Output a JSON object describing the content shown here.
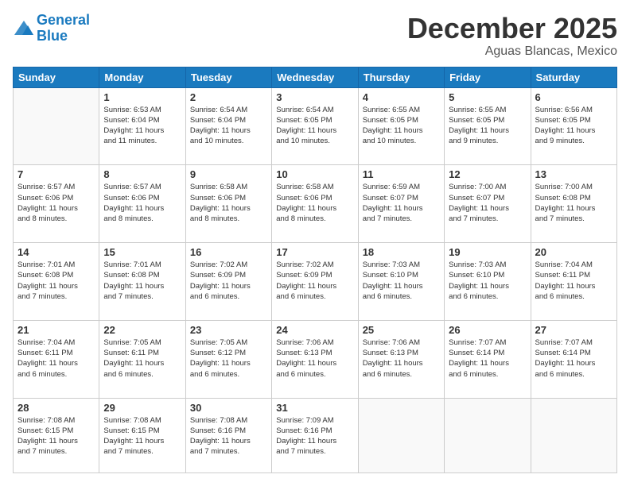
{
  "header": {
    "logo_line1": "General",
    "logo_line2": "Blue",
    "month": "December 2025",
    "location": "Aguas Blancas, Mexico"
  },
  "days_of_week": [
    "Sunday",
    "Monday",
    "Tuesday",
    "Wednesday",
    "Thursday",
    "Friday",
    "Saturday"
  ],
  "weeks": [
    [
      {
        "day": "",
        "info": ""
      },
      {
        "day": "1",
        "info": "Sunrise: 6:53 AM\nSunset: 6:04 PM\nDaylight: 11 hours\nand 11 minutes."
      },
      {
        "day": "2",
        "info": "Sunrise: 6:54 AM\nSunset: 6:04 PM\nDaylight: 11 hours\nand 10 minutes."
      },
      {
        "day": "3",
        "info": "Sunrise: 6:54 AM\nSunset: 6:05 PM\nDaylight: 11 hours\nand 10 minutes."
      },
      {
        "day": "4",
        "info": "Sunrise: 6:55 AM\nSunset: 6:05 PM\nDaylight: 11 hours\nand 10 minutes."
      },
      {
        "day": "5",
        "info": "Sunrise: 6:55 AM\nSunset: 6:05 PM\nDaylight: 11 hours\nand 9 minutes."
      },
      {
        "day": "6",
        "info": "Sunrise: 6:56 AM\nSunset: 6:05 PM\nDaylight: 11 hours\nand 9 minutes."
      }
    ],
    [
      {
        "day": "7",
        "info": "Sunrise: 6:57 AM\nSunset: 6:06 PM\nDaylight: 11 hours\nand 8 minutes."
      },
      {
        "day": "8",
        "info": "Sunrise: 6:57 AM\nSunset: 6:06 PM\nDaylight: 11 hours\nand 8 minutes."
      },
      {
        "day": "9",
        "info": "Sunrise: 6:58 AM\nSunset: 6:06 PM\nDaylight: 11 hours\nand 8 minutes."
      },
      {
        "day": "10",
        "info": "Sunrise: 6:58 AM\nSunset: 6:06 PM\nDaylight: 11 hours\nand 8 minutes."
      },
      {
        "day": "11",
        "info": "Sunrise: 6:59 AM\nSunset: 6:07 PM\nDaylight: 11 hours\nand 7 minutes."
      },
      {
        "day": "12",
        "info": "Sunrise: 7:00 AM\nSunset: 6:07 PM\nDaylight: 11 hours\nand 7 minutes."
      },
      {
        "day": "13",
        "info": "Sunrise: 7:00 AM\nSunset: 6:08 PM\nDaylight: 11 hours\nand 7 minutes."
      }
    ],
    [
      {
        "day": "14",
        "info": "Sunrise: 7:01 AM\nSunset: 6:08 PM\nDaylight: 11 hours\nand 7 minutes."
      },
      {
        "day": "15",
        "info": "Sunrise: 7:01 AM\nSunset: 6:08 PM\nDaylight: 11 hours\nand 7 minutes."
      },
      {
        "day": "16",
        "info": "Sunrise: 7:02 AM\nSunset: 6:09 PM\nDaylight: 11 hours\nand 6 minutes."
      },
      {
        "day": "17",
        "info": "Sunrise: 7:02 AM\nSunset: 6:09 PM\nDaylight: 11 hours\nand 6 minutes."
      },
      {
        "day": "18",
        "info": "Sunrise: 7:03 AM\nSunset: 6:10 PM\nDaylight: 11 hours\nand 6 minutes."
      },
      {
        "day": "19",
        "info": "Sunrise: 7:03 AM\nSunset: 6:10 PM\nDaylight: 11 hours\nand 6 minutes."
      },
      {
        "day": "20",
        "info": "Sunrise: 7:04 AM\nSunset: 6:11 PM\nDaylight: 11 hours\nand 6 minutes."
      }
    ],
    [
      {
        "day": "21",
        "info": "Sunrise: 7:04 AM\nSunset: 6:11 PM\nDaylight: 11 hours\nand 6 minutes."
      },
      {
        "day": "22",
        "info": "Sunrise: 7:05 AM\nSunset: 6:11 PM\nDaylight: 11 hours\nand 6 minutes."
      },
      {
        "day": "23",
        "info": "Sunrise: 7:05 AM\nSunset: 6:12 PM\nDaylight: 11 hours\nand 6 minutes."
      },
      {
        "day": "24",
        "info": "Sunrise: 7:06 AM\nSunset: 6:13 PM\nDaylight: 11 hours\nand 6 minutes."
      },
      {
        "day": "25",
        "info": "Sunrise: 7:06 AM\nSunset: 6:13 PM\nDaylight: 11 hours\nand 6 minutes."
      },
      {
        "day": "26",
        "info": "Sunrise: 7:07 AM\nSunset: 6:14 PM\nDaylight: 11 hours\nand 6 minutes."
      },
      {
        "day": "27",
        "info": "Sunrise: 7:07 AM\nSunset: 6:14 PM\nDaylight: 11 hours\nand 6 minutes."
      }
    ],
    [
      {
        "day": "28",
        "info": "Sunrise: 7:08 AM\nSunset: 6:15 PM\nDaylight: 11 hours\nand 7 minutes."
      },
      {
        "day": "29",
        "info": "Sunrise: 7:08 AM\nSunset: 6:15 PM\nDaylight: 11 hours\nand 7 minutes."
      },
      {
        "day": "30",
        "info": "Sunrise: 7:08 AM\nSunset: 6:16 PM\nDaylight: 11 hours\nand 7 minutes."
      },
      {
        "day": "31",
        "info": "Sunrise: 7:09 AM\nSunset: 6:16 PM\nDaylight: 11 hours\nand 7 minutes."
      },
      {
        "day": "",
        "info": ""
      },
      {
        "day": "",
        "info": ""
      },
      {
        "day": "",
        "info": ""
      }
    ]
  ]
}
